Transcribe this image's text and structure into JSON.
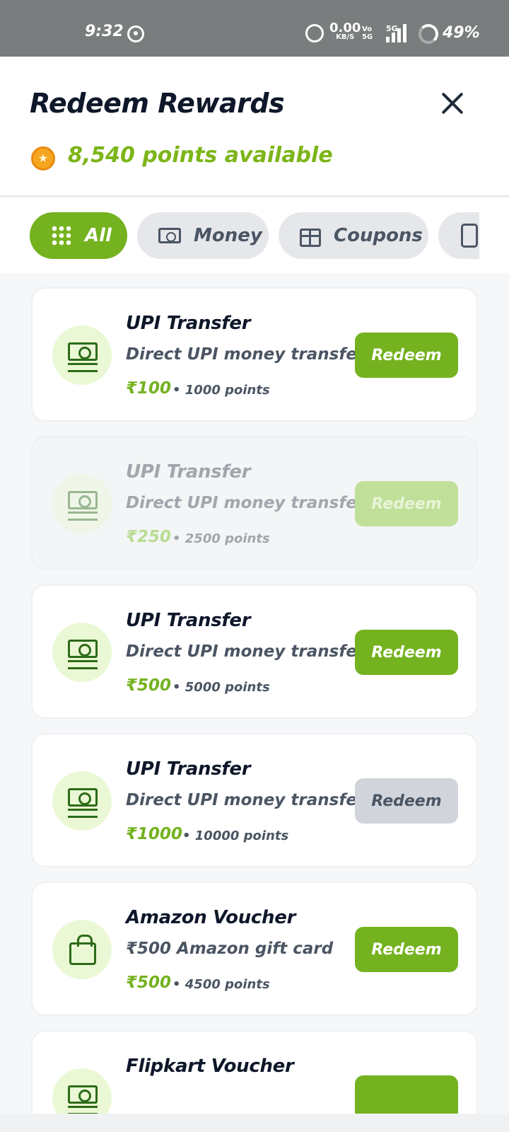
{
  "status_bar": {
    "time": "9:32",
    "net_speed": "0.00",
    "net_unit": "KB/S",
    "volte_top": "Vo",
    "volte_bottom": "5G",
    "signal_label": "5G",
    "battery": "49%"
  },
  "header": {
    "title": "Redeem Rewards",
    "points_available": "8,540 points available"
  },
  "tabs": [
    {
      "label": "All",
      "icon": "grid-icon",
      "active": true
    },
    {
      "label": "Money",
      "icon": "money-icon"
    },
    {
      "label": "Coupons",
      "icon": "gift-icon"
    },
    {
      "label": "",
      "icon": "phone-icon"
    }
  ],
  "rewards": [
    {
      "title": "UPI Transfer",
      "description": "Direct UPI money transfer",
      "amount": "₹100",
      "points": "• 1000 points",
      "button": "Redeem",
      "icon": "cash-icon",
      "state": "available"
    },
    {
      "title": "UPI Transfer",
      "description": "Direct UPI money transfer",
      "amount": "₹250",
      "points": "• 2500 points",
      "button": "Redeem",
      "icon": "cash-icon",
      "state": "disabled"
    },
    {
      "title": "UPI Transfer",
      "description": "Direct UPI money transfer",
      "amount": "₹500",
      "points": "• 5000 points",
      "button": "Redeem",
      "icon": "cash-icon",
      "state": "available"
    },
    {
      "title": "UPI Transfer",
      "description": "Direct UPI money transfer",
      "amount": "₹1000",
      "points": "• 10000 points",
      "button": "Redeem",
      "icon": "cash-icon",
      "state": "insufficient"
    },
    {
      "title": "Amazon Voucher",
      "description": "₹500 Amazon gift card",
      "amount": "₹500",
      "points": "• 4500 points",
      "button": "Redeem",
      "icon": "bag-icon",
      "state": "available"
    },
    {
      "title": "Flipkart Voucher",
      "description": "",
      "amount": "",
      "points": "",
      "button": "",
      "icon": "cash-icon",
      "state": "available"
    }
  ],
  "colors": {
    "accent": "#74b21f",
    "points_text": "#7cb518",
    "icon_bg": "#ebf8d5",
    "locked_button": "#d1d5db"
  }
}
